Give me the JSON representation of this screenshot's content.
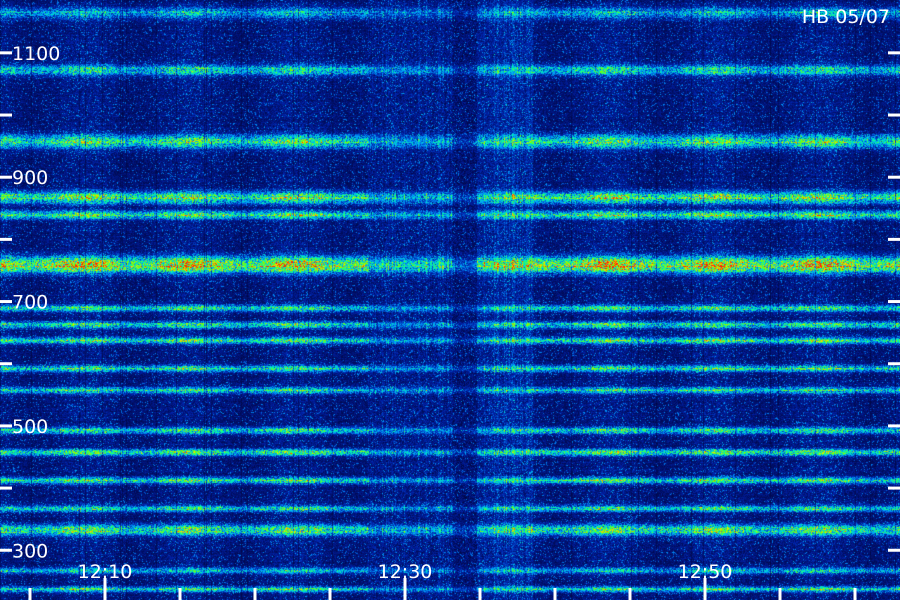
{
  "chart_data": {
    "type": "heatmap",
    "title": "HB 05/07",
    "xlabel": "",
    "ylabel": "",
    "x_range": [
      "12:03",
      "12:63"
    ],
    "x_ticks": [
      {
        "value": 10,
        "label": "12:10"
      },
      {
        "value": 30,
        "label": "12:30"
      },
      {
        "value": 50,
        "label": "12:50"
      }
    ],
    "ylim": [
      220,
      1185
    ],
    "y_ticks": [
      {
        "value": 1100,
        "label": "1100"
      },
      {
        "value": 900,
        "label": "900"
      },
      {
        "value": 700,
        "label": "700"
      },
      {
        "value": 500,
        "label": "500"
      },
      {
        "value": 300,
        "label": "300"
      }
    ],
    "y_minor_step": 100,
    "x_minor_step": 5,
    "colormap": [
      "#000030",
      "#0022aa",
      "#0099ff",
      "#00ffaa",
      "#77ff00",
      "#ffdd00",
      "#ff2200"
    ],
    "bands": [
      {
        "center": 1165,
        "width": 8,
        "intensity": 0.32
      },
      {
        "center": 1073,
        "width": 8,
        "intensity": 0.42
      },
      {
        "center": 958,
        "width": 10,
        "intensity": 0.52
      },
      {
        "center": 868,
        "width": 9,
        "intensity": 0.58
      },
      {
        "center": 840,
        "width": 6,
        "intensity": 0.55
      },
      {
        "center": 760,
        "width": 12,
        "intensity": 0.82
      },
      {
        "center": 690,
        "width": 5,
        "intensity": 0.48
      },
      {
        "center": 663,
        "width": 5,
        "intensity": 0.5
      },
      {
        "center": 638,
        "width": 5,
        "intensity": 0.48
      },
      {
        "center": 593,
        "width": 5,
        "intensity": 0.46
      },
      {
        "center": 558,
        "width": 5,
        "intensity": 0.44
      },
      {
        "center": 493,
        "width": 5,
        "intensity": 0.46
      },
      {
        "center": 458,
        "width": 5,
        "intensity": 0.5
      },
      {
        "center": 413,
        "width": 5,
        "intensity": 0.48
      },
      {
        "center": 368,
        "width": 5,
        "intensity": 0.44
      },
      {
        "center": 333,
        "width": 8,
        "intensity": 0.55
      },
      {
        "center": 268,
        "width": 4,
        "intensity": 0.4
      },
      {
        "center": 238,
        "width": 4,
        "intensity": 0.46
      }
    ],
    "gaps": [
      {
        "start": 27.5,
        "end": 31.2,
        "level": 0.45
      },
      {
        "start": 31.2,
        "end": 33.2,
        "level": 0.55
      },
      {
        "start": 33.2,
        "end": 34.8,
        "level": 0.3
      },
      {
        "start": 34.8,
        "end": 38.5,
        "level": 0.65
      }
    ]
  }
}
